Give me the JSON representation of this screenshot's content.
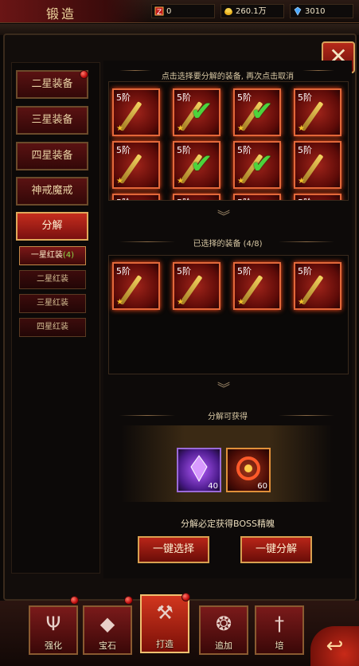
{
  "header": {
    "title": "锻造",
    "resources": [
      {
        "icon": "red-gem-icon",
        "value": "0"
      },
      {
        "icon": "gold-coin-icon",
        "value": "260.1万"
      },
      {
        "icon": "diamond-icon",
        "value": "3010"
      }
    ]
  },
  "close_label": "✕",
  "left_menu": {
    "items": [
      {
        "label": "二星装备",
        "badge": true
      },
      {
        "label": "三星装备",
        "badge": false
      },
      {
        "label": "四星装备",
        "badge": false
      },
      {
        "label": "神戒魔戒",
        "badge": false
      },
      {
        "label": "分解",
        "badge": false,
        "active": true
      }
    ],
    "sub_items": [
      {
        "label": "一星红装",
        "count": "(4)",
        "active": true
      },
      {
        "label": "二星红装",
        "count": ""
      },
      {
        "label": "三星红装",
        "count": ""
      },
      {
        "label": "四星红装",
        "count": ""
      }
    ]
  },
  "select_panel": {
    "hint": "点击选择要分解的装备, 再次点击取消",
    "item_level": "5阶",
    "items_checked": [
      false,
      true,
      true,
      false,
      false,
      true,
      true,
      false
    ]
  },
  "selected_panel": {
    "title": "已选择的装备 (4/8)",
    "item_level": "5阶",
    "count": 4
  },
  "reward_panel": {
    "title": "分解可获得",
    "rewards": [
      {
        "icon": "purple-crystal-icon",
        "count": "40"
      },
      {
        "icon": "red-boss-essence-icon",
        "count": "60"
      }
    ],
    "note": "分解必定获得BOSS精魄"
  },
  "actions": {
    "select_all": "一键选择",
    "decompose_all": "一键分解"
  },
  "bottom_nav": {
    "tabs": [
      {
        "label": "强化",
        "icon": "trident-icon",
        "badge": true
      },
      {
        "label": "宝石",
        "icon": "gem-icon",
        "badge": true
      },
      {
        "label": "打造",
        "icon": "hammer-icon",
        "badge": true,
        "active": true
      },
      {
        "label": "追加",
        "icon": "emblem-icon",
        "badge": false
      },
      {
        "label": "培",
        "icon": "sword-icon",
        "badge": false
      }
    ],
    "back_label": "↩"
  },
  "colors": {
    "accent_red": "#b82518",
    "gold_border": "#d8a050",
    "check_green": "#4cd43c"
  }
}
